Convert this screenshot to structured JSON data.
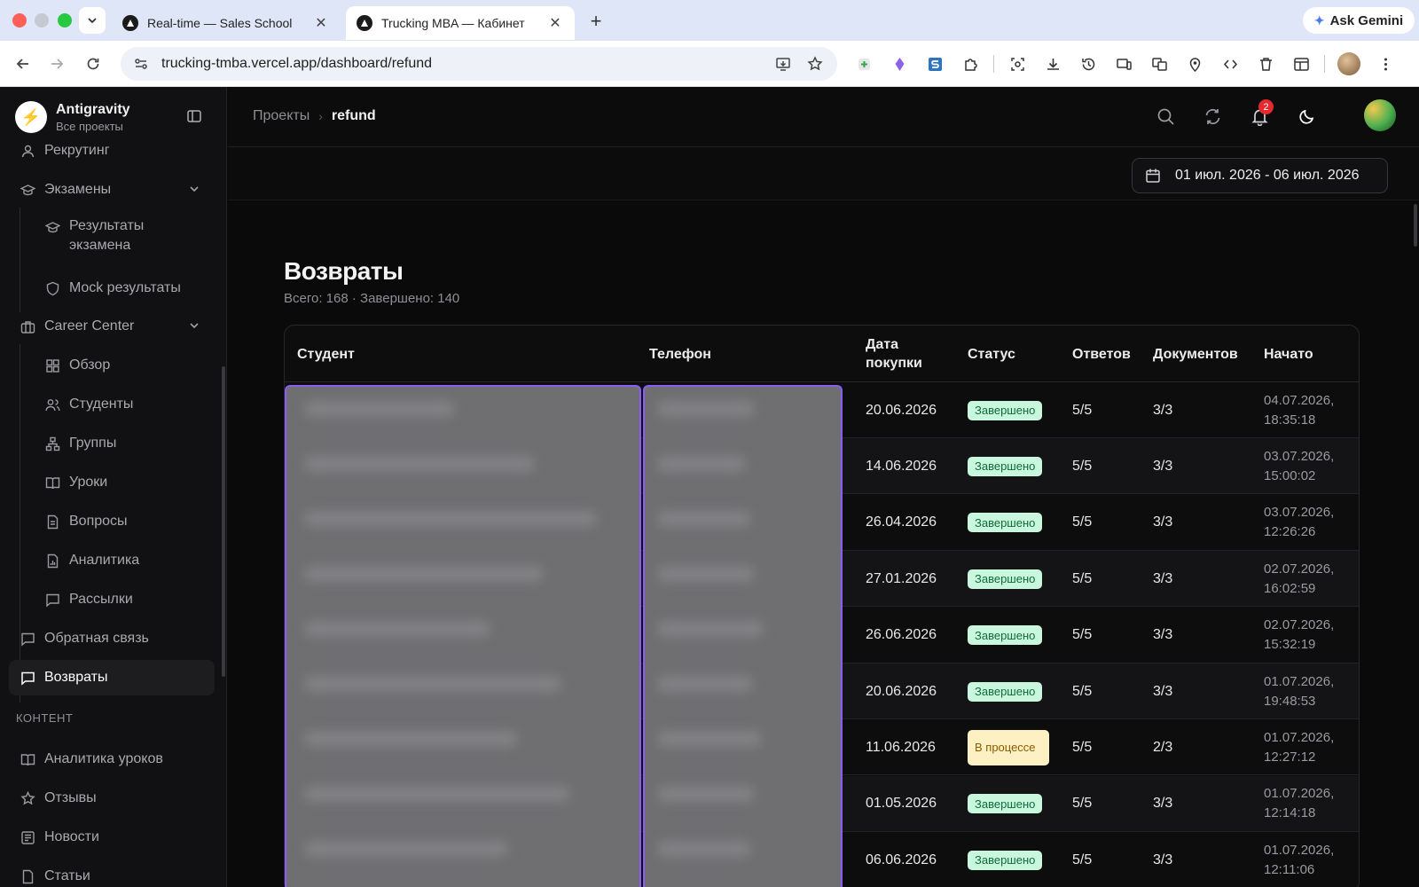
{
  "browser": {
    "tabs": [
      {
        "title": "Real-time — Sales School",
        "active": false
      },
      {
        "title": "Trucking MBA — Кабинет",
        "active": true
      }
    ],
    "tab_close": "✕",
    "new_tab": "+",
    "gemini_label": "Ask Gemini",
    "url": "trucking-tmba.vercel.app/dashboard/refund"
  },
  "app": {
    "brand_name": "Antigravity",
    "brand_sub": "Все проекты",
    "sidebar": {
      "items": [
        {
          "label": "Рекрутинг",
          "icon": "user-icon"
        },
        {
          "label": "Экзамены",
          "icon": "graduation-cap-icon",
          "expanded": true
        },
        {
          "label": "Результаты экзамена",
          "icon": "graduation-cap-icon"
        },
        {
          "label": "Mock результаты",
          "icon": "shield-icon"
        },
        {
          "label": "Career Center",
          "icon": "briefcase-icon",
          "expanded": true
        },
        {
          "label": "Обзор",
          "icon": "grid-icon"
        },
        {
          "label": "Студенты",
          "icon": "users-icon"
        },
        {
          "label": "Группы",
          "icon": "network-icon"
        },
        {
          "label": "Уроки",
          "icon": "book-icon"
        },
        {
          "label": "Вопросы",
          "icon": "file-icon"
        },
        {
          "label": "Аналитика",
          "icon": "chart-icon"
        },
        {
          "label": "Рассылки",
          "icon": "message-icon"
        },
        {
          "label": "Обратная связь",
          "icon": "message-icon"
        },
        {
          "label": "Возвраты",
          "icon": "message-icon",
          "active": true
        }
      ],
      "section_content": "КОНТЕНТ",
      "content_items": [
        {
          "label": "Аналитика уроков",
          "icon": "book-icon"
        },
        {
          "label": "Отзывы",
          "icon": "star-icon"
        },
        {
          "label": "Новости",
          "icon": "newspaper-icon"
        },
        {
          "label": "Статьи",
          "icon": "file-icon"
        }
      ]
    },
    "breadcrumb": {
      "parent": "Проекты",
      "separator": "›",
      "current": "refund"
    },
    "notifications_count": "2",
    "date_range": "01 июл. 2026 - 06 июл. 2026",
    "page": {
      "title": "Возвраты",
      "subtitle": "Всего: 168 · Завершено: 140"
    },
    "table": {
      "columns": [
        "Студент",
        "Телефон",
        "Дата покупки",
        "Статус",
        "Ответов",
        "Документов",
        "Начато"
      ],
      "rows": [
        {
          "date": "20.06.2026",
          "status": "Завершено",
          "status_kind": "done",
          "answers": "5/5",
          "docs": "3/3",
          "started_date": "04.07.2026,",
          "started_time": "18:35:18"
        },
        {
          "date": "14.06.2026",
          "status": "Завершено",
          "status_kind": "done",
          "answers": "5/5",
          "docs": "3/3",
          "started_date": "03.07.2026,",
          "started_time": "15:00:02"
        },
        {
          "date": "26.04.2026",
          "status": "Завершено",
          "status_kind": "done",
          "answers": "5/5",
          "docs": "3/3",
          "started_date": "03.07.2026,",
          "started_time": "12:26:26"
        },
        {
          "date": "27.01.2026",
          "status": "Завершено",
          "status_kind": "done",
          "answers": "5/5",
          "docs": "3/3",
          "started_date": "02.07.2026,",
          "started_time": "16:02:59"
        },
        {
          "date": "26.06.2026",
          "status": "Завершено",
          "status_kind": "done",
          "answers": "5/5",
          "docs": "3/3",
          "started_date": "02.07.2026,",
          "started_time": "15:32:19"
        },
        {
          "date": "20.06.2026",
          "status": "Завершено",
          "status_kind": "done",
          "answers": "5/5",
          "docs": "3/3",
          "started_date": "01.07.2026,",
          "started_time": "19:48:53"
        },
        {
          "date": "11.06.2026",
          "status": "В процессе",
          "status_kind": "progress",
          "answers": "5/5",
          "docs": "2/3",
          "started_date": "01.07.2026,",
          "started_time": "12:27:12"
        },
        {
          "date": "01.05.2026",
          "status": "Завершено",
          "status_kind": "done",
          "answers": "5/5",
          "docs": "3/3",
          "started_date": "01.07.2026,",
          "started_time": "12:14:18"
        },
        {
          "date": "06.06.2026",
          "status": "Завершено",
          "status_kind": "done",
          "answers": "5/5",
          "docs": "3/3",
          "started_date": "01.07.2026,",
          "started_time": "12:11:06"
        }
      ]
    }
  },
  "colors": {
    "background": "#0a0a0b",
    "done_badge_bg": "#c9f7dd",
    "done_badge_text": "#116a3a",
    "progress_badge_bg": "#fdf1c4",
    "progress_badge_text": "#8a5a00",
    "redaction_border": "#8b5cf6",
    "notification_badge": "#e5292f"
  }
}
